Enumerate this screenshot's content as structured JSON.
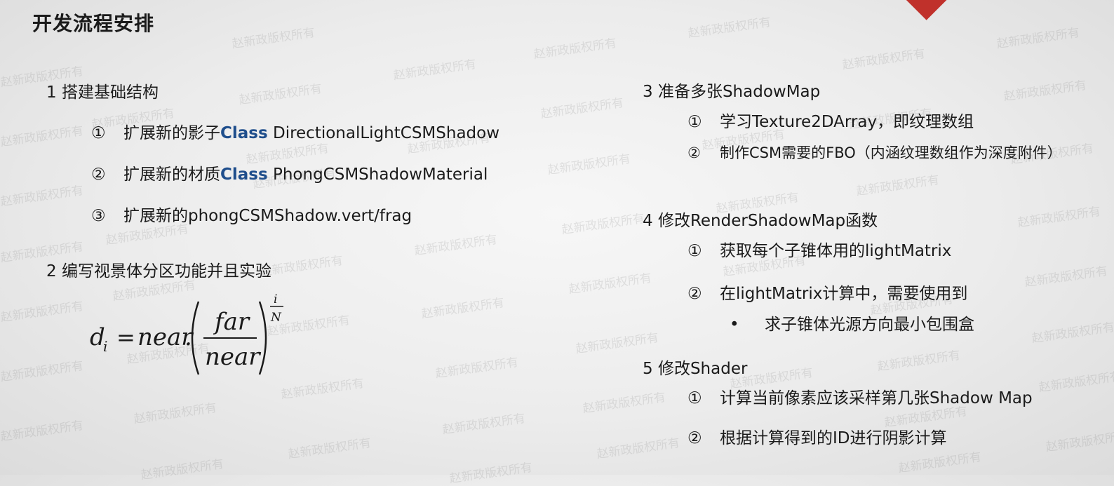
{
  "title": "开发流程安排",
  "watermark": "赵新政版权所有",
  "sections": {
    "s1": {
      "heading": "1 搭建基础结构",
      "items": [
        {
          "num": "①",
          "prefix": "扩展新的影子",
          "cls": "Class",
          "suffix": " DirectionalLightCSMShadow"
        },
        {
          "num": "②",
          "prefix": "扩展新的材质",
          "cls": "Class",
          "suffix": " PhongCSMShadowMaterial"
        },
        {
          "num": "③",
          "text": "扩展新的phongCSMShadow.vert/frag"
        }
      ]
    },
    "s2": {
      "heading": "2 编写视景体分区功能并且实验",
      "formula": {
        "d": "d",
        "sub_i": "i",
        "eq": "=",
        "near": "near",
        "dot": ".",
        "far": "far",
        "exp_i": "i",
        "exp_N": "N"
      }
    },
    "s3": {
      "heading": "3 准备多张ShadowMap",
      "items": [
        {
          "num": "①",
          "text": "学习Texture2DArray，即纹理数组"
        },
        {
          "num": "②",
          "text": "制作CSM需要的FBO（内涵纹理数组作为深度附件）"
        }
      ]
    },
    "s4": {
      "heading": "4 修改RenderShadowMap函数",
      "items": [
        {
          "num": "①",
          "text": "获取每个子锥体用的lightMatrix"
        },
        {
          "num": "②",
          "text": "在lightMatrix计算中，需要使用到"
        }
      ],
      "bullet": {
        "mark": "•",
        "text": "求子锥体光源方向最小包围盒"
      }
    },
    "s5": {
      "heading": "5 修改Shader",
      "items": [
        {
          "num": "①",
          "text": "计算当前像素应该采样第几张Shadow Map"
        },
        {
          "num": "②",
          "text": "根据计算得到的ID进行阴影计算"
        }
      ]
    }
  }
}
